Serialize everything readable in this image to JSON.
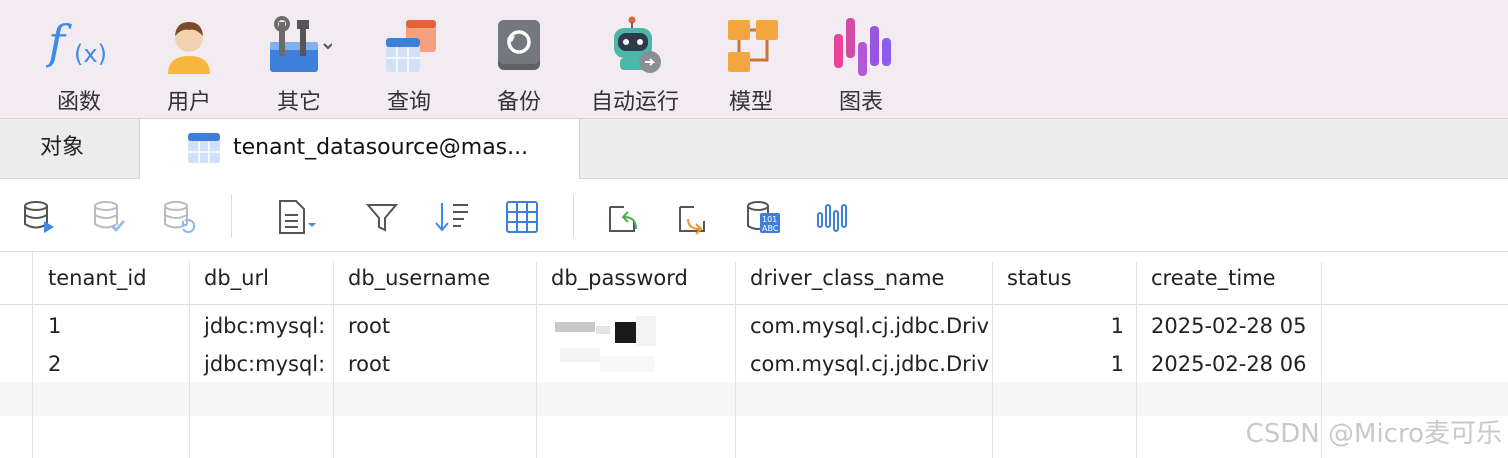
{
  "toolbar": {
    "items": [
      {
        "label": "函数",
        "icon": "function-icon"
      },
      {
        "label": "用户",
        "icon": "user-icon"
      },
      {
        "label": "其它",
        "icon": "tools-icon"
      },
      {
        "label": "查询",
        "icon": "query-icon"
      },
      {
        "label": "备份",
        "icon": "backup-icon"
      },
      {
        "label": "自动运行",
        "icon": "robot-icon"
      },
      {
        "label": "模型",
        "icon": "model-icon"
      },
      {
        "label": "图表",
        "icon": "chart-icon"
      }
    ]
  },
  "tabs": {
    "objects": "对象",
    "active": "tenant_datasource@mas..."
  },
  "table": {
    "columns": [
      "tenant_id",
      "db_url",
      "db_username",
      "db_password",
      "driver_class_name",
      "status",
      "create_time"
    ],
    "rows": [
      {
        "tenant_id": "1",
        "db_url": "jdbc:mysql:",
        "db_username": "root",
        "db_password": "",
        "driver_class_name": "com.mysql.cj.jdbc.Driv",
        "status": "1",
        "create_time": "2025-02-28 05"
      },
      {
        "tenant_id": "2",
        "db_url": "jdbc:mysql:",
        "db_username": "root",
        "db_password": "",
        "driver_class_name": "com.mysql.cj.jdbc.Driv",
        "status": "1",
        "create_time": "2025-02-28 06"
      }
    ]
  },
  "watermark": "CSDN @Micro麦可乐"
}
